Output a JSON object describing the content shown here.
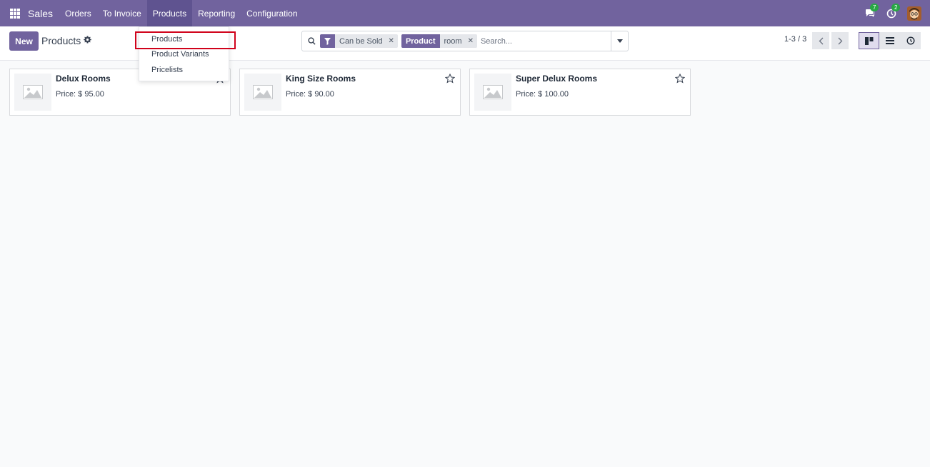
{
  "navbar": {
    "brand": "Sales",
    "menu": [
      {
        "label": "Orders"
      },
      {
        "label": "To Invoice"
      },
      {
        "label": "Products"
      },
      {
        "label": "Reporting"
      },
      {
        "label": "Configuration"
      }
    ],
    "messages_count": "7",
    "activities_count": "2"
  },
  "control_panel": {
    "new_label": "New",
    "title": "Products",
    "search": {
      "filter_facet": "Can be Sold",
      "field_facet_label": "Product",
      "field_facet_value": "room",
      "placeholder": "Search..."
    },
    "pager": "1-3 / 3"
  },
  "dropdown": {
    "items": [
      {
        "label": "Products"
      },
      {
        "label": "Product Variants"
      },
      {
        "label": "Pricelists"
      }
    ]
  },
  "products": [
    {
      "name": "Delux Rooms",
      "price": "Price: $ 95.00"
    },
    {
      "name": "King Size Rooms",
      "price": "Price: $ 90.00"
    },
    {
      "name": "Super Delux Rooms",
      "price": "Price: $ 100.00"
    }
  ],
  "colors": {
    "brand": "#71639e",
    "highlight": "#d0021b",
    "badge": "#28a745"
  }
}
